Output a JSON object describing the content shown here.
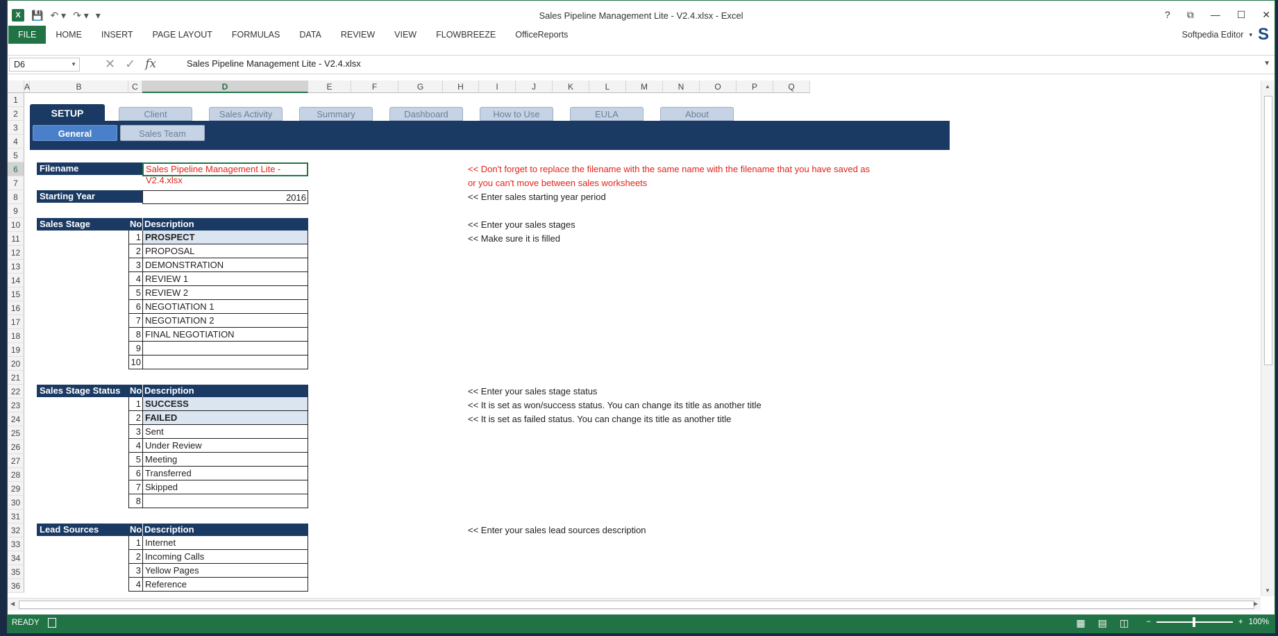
{
  "window": {
    "title": "Sales Pipeline Management Lite - V2.4.xlsx - Excel",
    "controls": [
      "?",
      "⧉",
      "—",
      "☐",
      "✕"
    ]
  },
  "quick_access": {
    "logo": "X",
    "save_icon": "save-icon",
    "undo_icon": "undo-icon",
    "redo_icon": "redo-icon"
  },
  "ribbon": {
    "tabs": [
      "FILE",
      "HOME",
      "INSERT",
      "PAGE LAYOUT",
      "FORMULAS",
      "DATA",
      "REVIEW",
      "VIEW",
      "FLOWBREEZE",
      "OfficeReports"
    ],
    "user": "Softpedia Editor",
    "accent": "#217346"
  },
  "formula_bar": {
    "cell_ref": "D6",
    "formula": "Sales Pipeline Management Lite - V2.4.xlsx"
  },
  "columns": [
    "A",
    "B",
    "C",
    "D",
    "E",
    "F",
    "G",
    "H",
    "I",
    "J",
    "K",
    "L",
    "M",
    "N",
    "O",
    "P",
    "Q"
  ],
  "selected_column": "D",
  "rows": [
    "1",
    "2",
    "3",
    "4",
    "5",
    "6",
    "7",
    "8",
    "9",
    "10",
    "11",
    "12",
    "13",
    "14",
    "15",
    "16",
    "17",
    "18",
    "19",
    "20",
    "21",
    "22",
    "23",
    "24",
    "25",
    "26",
    "27",
    "28",
    "29",
    "30",
    "31",
    "32",
    "33",
    "34",
    "35",
    "36"
  ],
  "selected_row": "6",
  "sheet_nav": {
    "tabs": [
      "SETUP",
      "Client",
      "Sales Activity",
      "Summary",
      "Dashboard",
      "How to Use",
      "EULA",
      "About"
    ],
    "subtabs": [
      "General",
      "Sales Team"
    ],
    "band_color": "#1a3a63"
  },
  "filename": {
    "label": "Filename",
    "value": "Sales Pipeline Management Lite - V2.4.xlsx"
  },
  "starting_year": {
    "label": "Starting Year",
    "value": "2016"
  },
  "table_headers": {
    "no": "No",
    "desc": "Description"
  },
  "sales_stage": {
    "label": "Sales Stage",
    "items": [
      {
        "no": "1",
        "desc": "PROSPECT"
      },
      {
        "no": "2",
        "desc": "PROPOSAL"
      },
      {
        "no": "3",
        "desc": "DEMONSTRATION"
      },
      {
        "no": "4",
        "desc": "REVIEW 1"
      },
      {
        "no": "5",
        "desc": "REVIEW 2"
      },
      {
        "no": "6",
        "desc": "NEGOTIATION 1"
      },
      {
        "no": "7",
        "desc": "NEGOTIATION 2"
      },
      {
        "no": "8",
        "desc": "FINAL NEGOTIATION"
      },
      {
        "no": "9",
        "desc": ""
      },
      {
        "no": "10",
        "desc": ""
      }
    ]
  },
  "sales_stage_status": {
    "label": "Sales Stage Status",
    "items": [
      {
        "no": "1",
        "desc": "SUCCESS"
      },
      {
        "no": "2",
        "desc": "FAILED"
      },
      {
        "no": "3",
        "desc": "Sent"
      },
      {
        "no": "4",
        "desc": "Under Review"
      },
      {
        "no": "5",
        "desc": "Meeting"
      },
      {
        "no": "6",
        "desc": "Transferred"
      },
      {
        "no": "7",
        "desc": "Skipped"
      },
      {
        "no": "8",
        "desc": ""
      }
    ]
  },
  "lead_sources": {
    "label": "Lead Sources",
    "items": [
      {
        "no": "1",
        "desc": "Internet"
      },
      {
        "no": "2",
        "desc": "Incoming Calls"
      },
      {
        "no": "3",
        "desc": "Yellow Pages"
      },
      {
        "no": "4",
        "desc": "Reference"
      }
    ]
  },
  "notes": {
    "filename_1": "<< Don't forget to replace the filename with the same name with the filename that you have saved as",
    "filename_2": "or you can't move between sales worksheets",
    "year": "<< Enter sales starting year period",
    "stages_1": "<< Enter your sales stages",
    "stages_2": "<< Make sure it is filled",
    "status_1": "<< Enter your sales stage status",
    "status_2": "<< It is set as won/success status. You can change its title as another title",
    "status_3": "<< It is set as failed status. You can change its title as another title",
    "lead": "<< Enter your sales lead sources description"
  },
  "status_bar": {
    "ready": "READY",
    "zoom": "100%"
  }
}
